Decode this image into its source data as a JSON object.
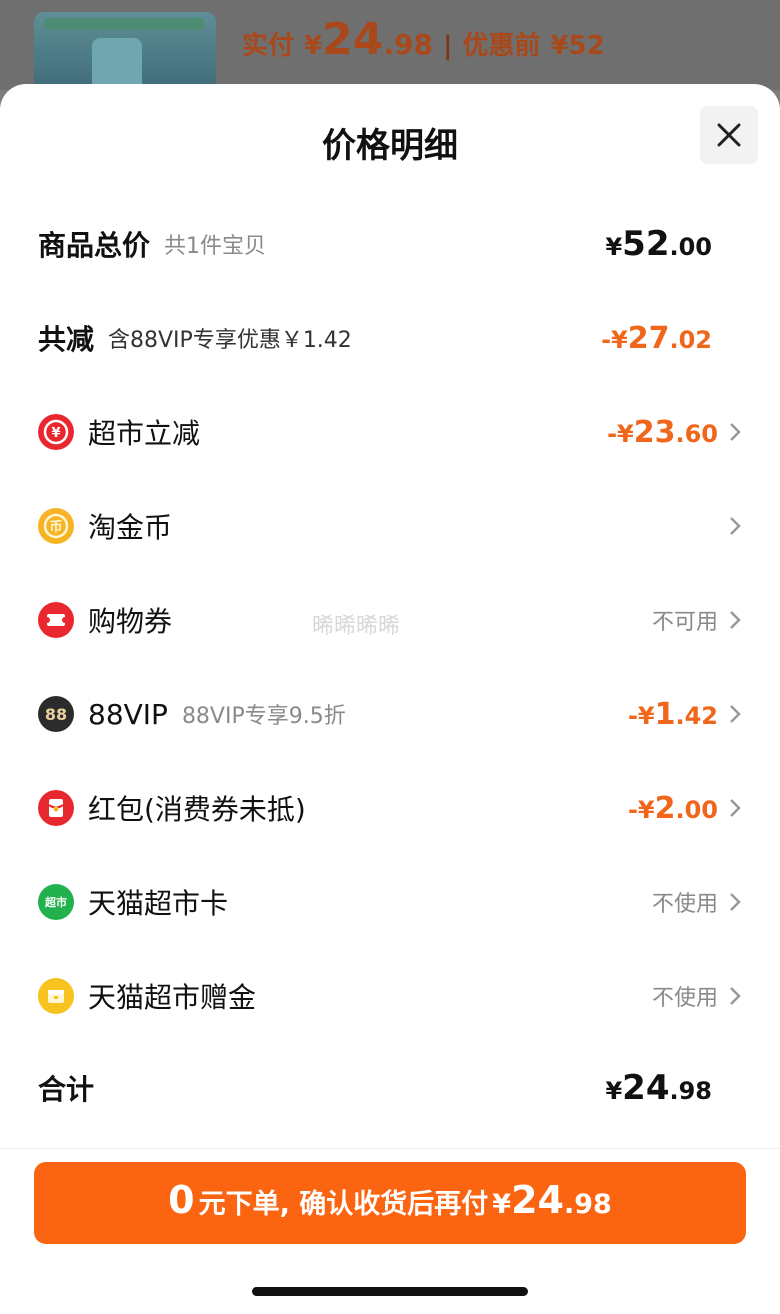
{
  "background": {
    "price_label": "实付",
    "price_currency": "¥",
    "price_int": "24",
    "price_dec": ".98",
    "separator": "|",
    "before_label": "优惠前",
    "before_value": "¥52"
  },
  "sheet": {
    "title": "价格明细",
    "close_icon": "close-icon"
  },
  "rows": {
    "total": {
      "label": "商品总价",
      "sub": "共1件宝贝",
      "cur": "¥",
      "int": "52",
      "dec": ".00"
    },
    "reduce": {
      "label": "共减",
      "sub": "含88VIP专享优惠￥1.42",
      "cur": "-¥",
      "int": "27",
      "dec": ".02"
    },
    "supermarket": {
      "label": "超市立减",
      "cur": "-¥",
      "int": "23",
      "dec": ".60",
      "icon": "yuan-icon"
    },
    "coin": {
      "label": "淘金币",
      "icon": "coin-icon"
    },
    "voucher": {
      "label": "购物券",
      "status": "不可用",
      "icon": "ticket-icon"
    },
    "vip": {
      "label": "88VIP",
      "sub": "88VIP专享9.5折",
      "cur": "-¥",
      "int": "1",
      "dec": ".42",
      "icon": "88vip-icon",
      "icon_text": "88"
    },
    "redpacket": {
      "label": "红包(消费券未抵)",
      "cur": "-¥",
      "int": "2",
      "dec": ".00",
      "icon": "red-packet-icon"
    },
    "card": {
      "label": "天猫超市卡",
      "status": "不使用",
      "icon": "tmall-card-icon",
      "icon_text": "超市"
    },
    "gift": {
      "label": "天猫超市赠金",
      "status": "不使用",
      "icon": "gift-money-icon"
    },
    "sum": {
      "label": "合计",
      "cur": "¥",
      "int": "24",
      "dec": ".98"
    }
  },
  "watermark": "晞晞晞晞",
  "cta": {
    "zero": "0",
    "text": "元下单, 确认收货后再付",
    "cur": "¥",
    "int": "24",
    "dec": ".98"
  },
  "colors": {
    "accent": "#fb6410",
    "discount": "#f0661a",
    "red_icon": "#e8282e",
    "gold_icon": "#f6b425",
    "vip_icon": "#2b2b2b",
    "green_icon": "#23b14d"
  }
}
